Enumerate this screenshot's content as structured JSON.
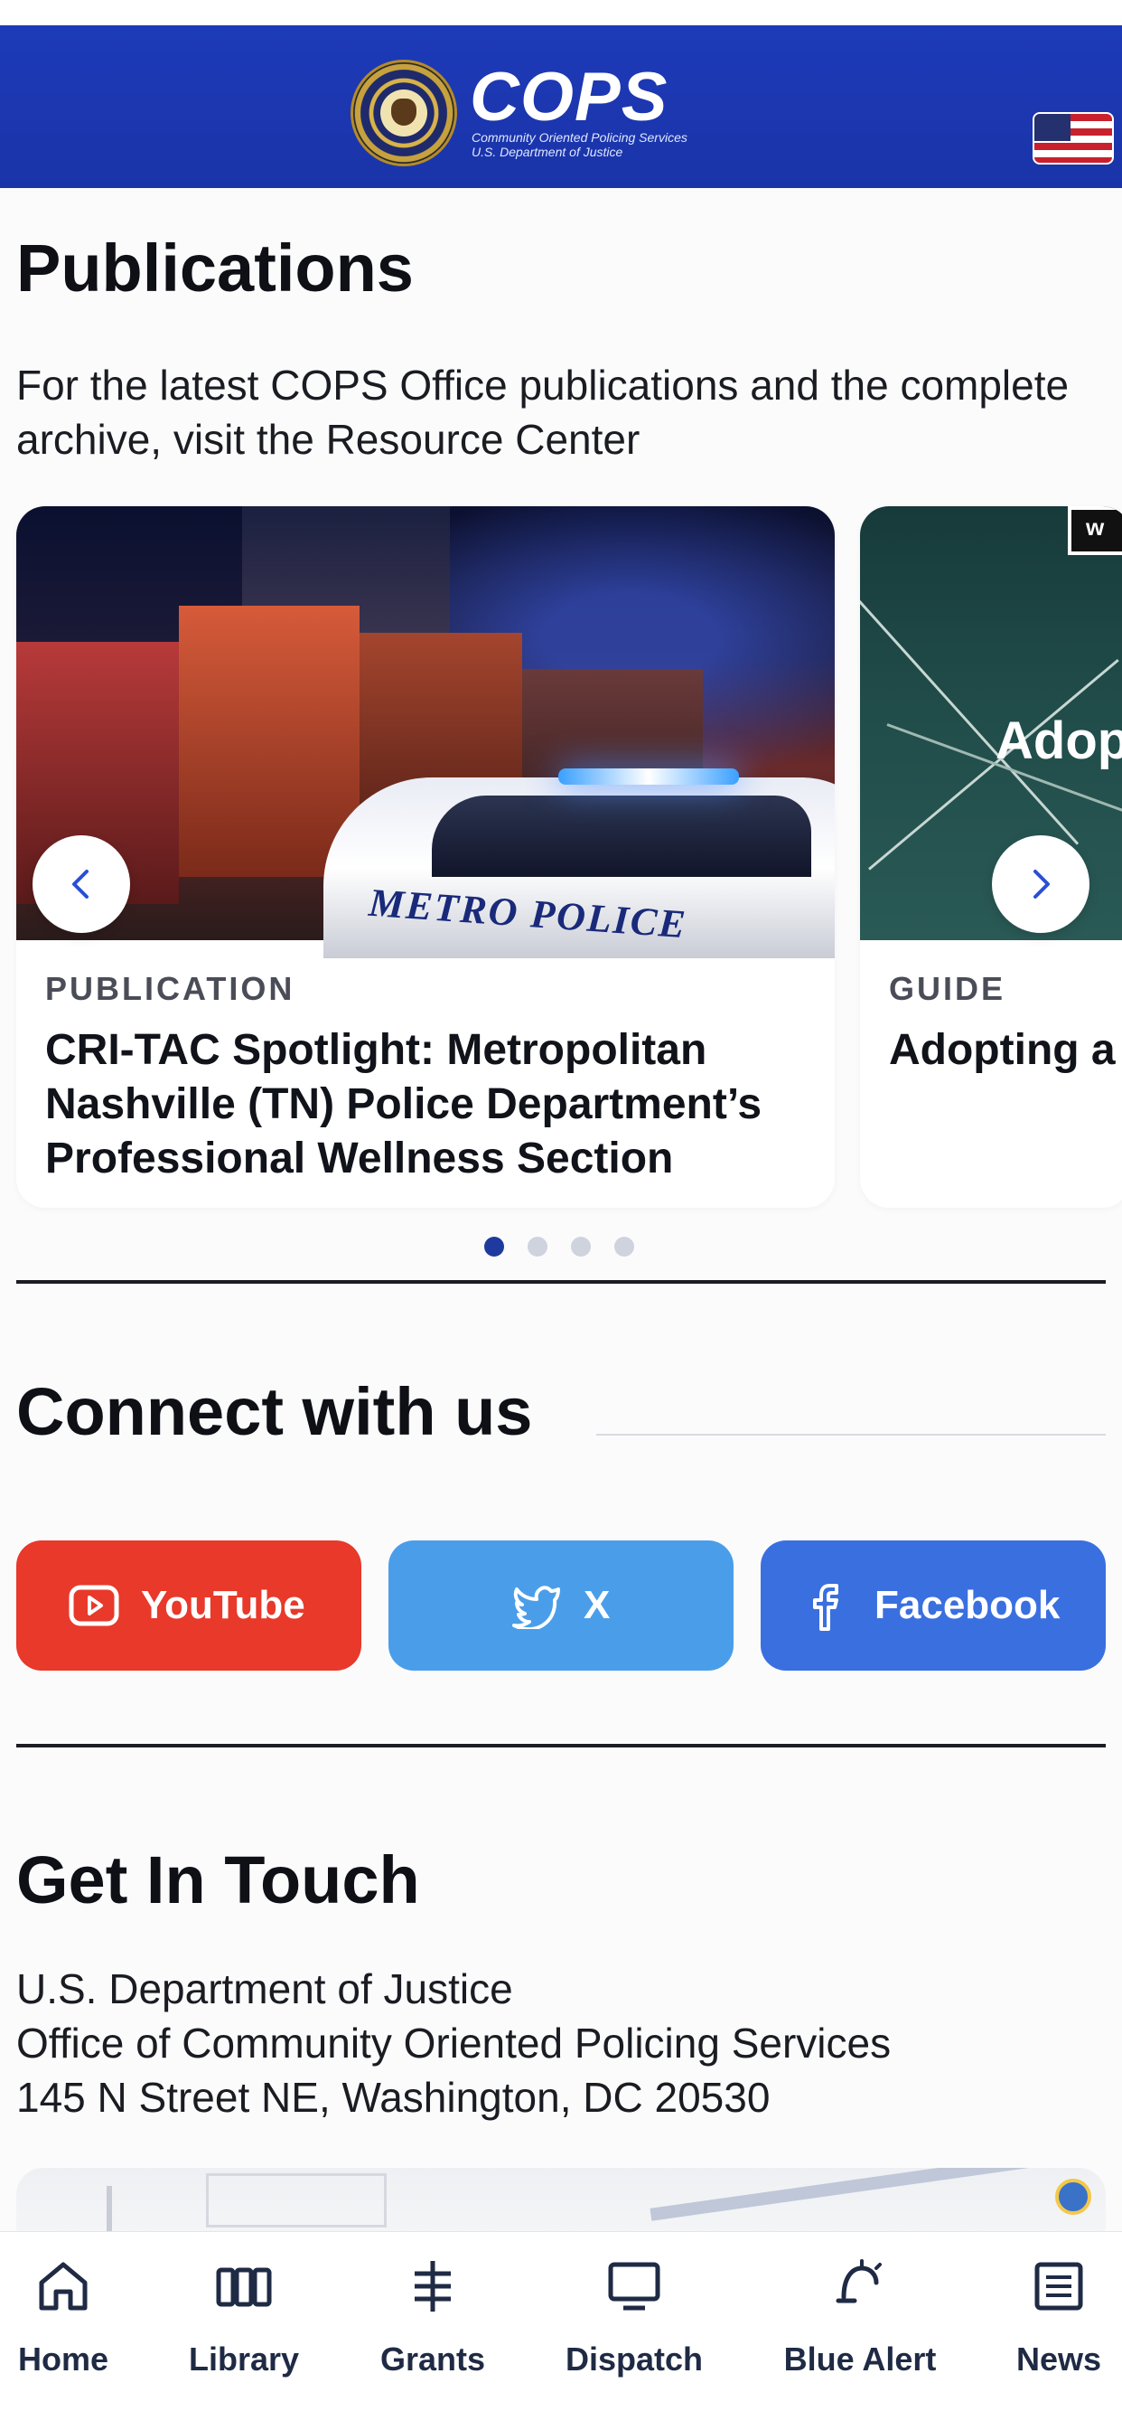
{
  "header": {
    "logo_title": "COPS",
    "logo_sub_1": "Community Oriented Policing Services",
    "logo_sub_2": "U.S. Department of Justice",
    "seal_text": "DEPARTMENT OF JUSTICE"
  },
  "publications": {
    "title": "Publications",
    "description": "For the latest COPS Office publications and the complete archive, visit the Resource Center",
    "cards": [
      {
        "type": "PUBLICATION",
        "title": "CRI-TAC Spotlight: Metropolitan Nashville (TN) Police Department’s Professional Wellness Section",
        "image_text": "METRO POLICE"
      },
      {
        "type": "GUIDE",
        "title": "Adopting a Police Stat",
        "image_text_1": "Adop",
        "image_text_2": "w"
      }
    ],
    "page_count": 4,
    "active_page": 1
  },
  "connect": {
    "title": "Connect with us",
    "buttons": [
      {
        "label": "YouTube",
        "icon": "youtube-icon",
        "color": "#e8392a"
      },
      {
        "label": "X",
        "icon": "twitter-bird-icon",
        "color": "#4a9ee9"
      },
      {
        "label": "Facebook",
        "icon": "facebook-icon",
        "color": "#3a6fe0"
      }
    ]
  },
  "contact": {
    "title": "Get In Touch",
    "address_lines": [
      "U.S. Department of Justice",
      "Office of Community Oriented Policing Services",
      "145 N Street NE, Washington, DC 20530"
    ]
  },
  "tabbar": {
    "items": [
      {
        "label": "Home",
        "icon": "home-icon"
      },
      {
        "label": "Library",
        "icon": "library-icon"
      },
      {
        "label": "Grants",
        "icon": "grants-icon"
      },
      {
        "label": "Dispatch",
        "icon": "dispatch-icon"
      },
      {
        "label": "Blue Alert",
        "icon": "blue-alert-icon"
      },
      {
        "label": "News",
        "icon": "news-icon"
      }
    ]
  },
  "colors": {
    "header_blue": "#1d3ab8",
    "active_dot": "#1f3a9e",
    "tab_text": "#1f2a44"
  }
}
